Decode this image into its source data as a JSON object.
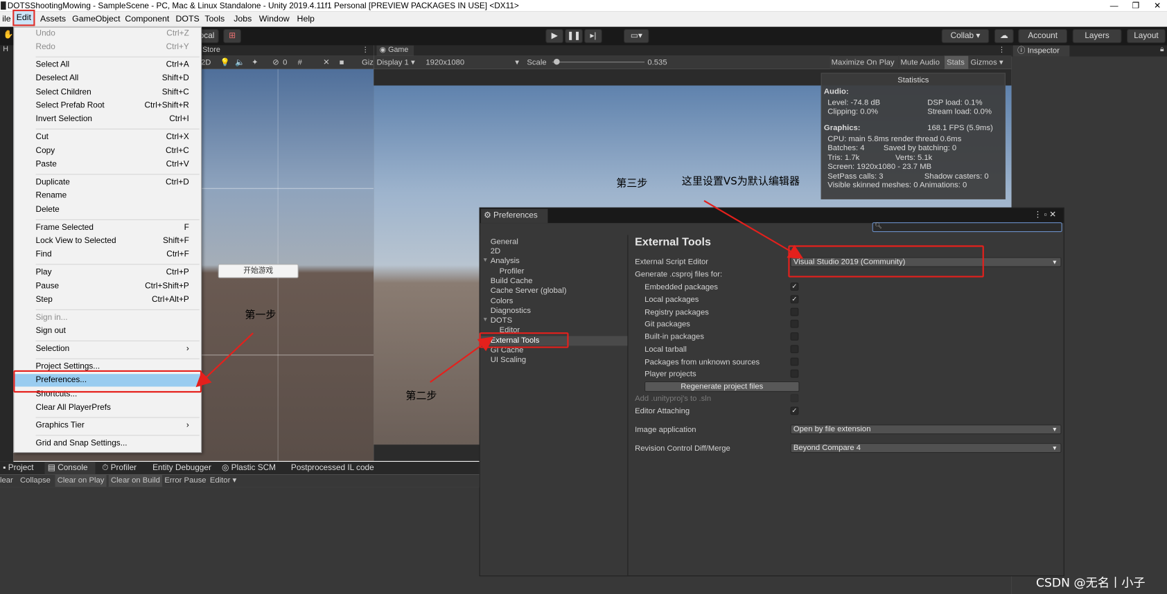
{
  "window": {
    "title": "DOTSShootingMowing - SampleScene - PC, Mac & Linux Standalone - Unity 2019.4.11f1 Personal [PREVIEW PACKAGES IN USE] <DX11>",
    "minimize": "—",
    "restore": "❐",
    "close": "✕"
  },
  "menubar": [
    "ile",
    "Edit",
    "Assets",
    "GameObject",
    "Component",
    "DOTS",
    "Tools",
    "Jobs",
    "Window",
    "Help"
  ],
  "toolbar": {
    "pivot": "ocal",
    "collab": "Collab ▾",
    "account": "Account",
    "layers": "Layers",
    "layout": "Layout"
  },
  "scene_header": {
    "h_tab": "H",
    "store_tab": "Store"
  },
  "scene_toolbar": {
    "mode": "2D",
    "gizmo_count": "0",
    "gizmos": "Giz"
  },
  "scene_button": "开始游戏",
  "game_header": {
    "tab": "Game"
  },
  "game_toolbar": {
    "display": "Display 1",
    "resolution": "1920x1080",
    "scale_label": "Scale",
    "scale_value": "0.535",
    "scale_fraction": 0.02,
    "maximize": "Maximize On Play",
    "mute": "Mute Audio",
    "stats": "Stats",
    "gizmos": "Gizmos"
  },
  "statistics": {
    "title": "Statistics",
    "audio_header": "Audio:",
    "level": "Level: -74.8 dB",
    "dsp": "DSP load: 0.1%",
    "clipping": "Clipping: 0.0%",
    "stream": "Stream load: 0.0%",
    "graphics_header": "Graphics:",
    "fps": "168.1 FPS (5.9ms)",
    "cpu": "CPU: main 5.8ms  render thread 0.6ms",
    "batches": "Batches: 4",
    "saved_batching": "Saved by batching: 0",
    "tris": "Tris: 1.7k",
    "verts": "Verts: 5.1k",
    "screen": "Screen: 1920x1080 - 23.7 MB",
    "setpass": "SetPass calls: 3",
    "shadow": "Shadow casters: 0",
    "skinned": "Visible skinned meshes: 0  Animations: 0"
  },
  "inspector": {
    "tab": "Inspector"
  },
  "bottom_tabs": [
    "Project",
    "Console",
    "Profiler",
    "Entity Debugger",
    "Plastic SCM",
    "Postprocessed IL code"
  ],
  "console_bar": [
    "lear",
    "Collapse",
    "Clear on Play",
    "Clear on Build",
    "Error Pause",
    "Editor ▾"
  ],
  "edit_menu": [
    {
      "label": "Undo",
      "shortcut": "Ctrl+Z",
      "disabled": true
    },
    {
      "label": "Redo",
      "shortcut": "Ctrl+Y",
      "disabled": true
    },
    {
      "label": "Select All",
      "shortcut": "Ctrl+A"
    },
    {
      "label": "Deselect All",
      "shortcut": "Shift+D"
    },
    {
      "label": "Select Children",
      "shortcut": "Shift+C"
    },
    {
      "label": "Select Prefab Root",
      "shortcut": "Ctrl+Shift+R"
    },
    {
      "label": "Invert Selection",
      "shortcut": "Ctrl+I"
    },
    {
      "label": "Cut",
      "shortcut": "Ctrl+X"
    },
    {
      "label": "Copy",
      "shortcut": "Ctrl+C"
    },
    {
      "label": "Paste",
      "shortcut": "Ctrl+V"
    },
    {
      "label": "Duplicate",
      "shortcut": "Ctrl+D"
    },
    {
      "label": "Rename",
      "shortcut": ""
    },
    {
      "label": "Delete",
      "shortcut": ""
    },
    {
      "label": "Frame Selected",
      "shortcut": "F"
    },
    {
      "label": "Lock View to Selected",
      "shortcut": "Shift+F"
    },
    {
      "label": "Find",
      "shortcut": "Ctrl+F"
    },
    {
      "label": "Play",
      "shortcut": "Ctrl+P"
    },
    {
      "label": "Pause",
      "shortcut": "Ctrl+Shift+P"
    },
    {
      "label": "Step",
      "shortcut": "Ctrl+Alt+P"
    },
    {
      "label": "Sign in...",
      "shortcut": "",
      "disabled": true
    },
    {
      "label": "Sign out",
      "shortcut": ""
    },
    {
      "label": "Selection",
      "shortcut": "›"
    },
    {
      "label": "Project Settings...",
      "shortcut": ""
    },
    {
      "label": "Preferences...",
      "shortcut": "",
      "highlighted": true
    },
    {
      "label": "Shortcuts...",
      "shortcut": ""
    },
    {
      "label": "Clear All PlayerPrefs",
      "shortcut": ""
    },
    {
      "label": "Graphics Tier",
      "shortcut": "›"
    },
    {
      "label": "Grid and Snap Settings...",
      "shortcut": ""
    }
  ],
  "preferences": {
    "tab": "Preferences",
    "sidebar": [
      "General",
      "2D",
      "Analysis",
      "Profiler",
      "Build Cache",
      "Cache Server (global)",
      "Colors",
      "Diagnostics",
      "DOTS",
      "Editor",
      "External Tools",
      "GI Cache",
      "UI Scaling"
    ],
    "selected": "External Tools",
    "heading": "External Tools",
    "external_script_editor_label": "External Script Editor",
    "external_script_editor_value": "Visual Studio 2019 (Community)",
    "generate_label": "Generate .csproj files for:",
    "generate_options": [
      {
        "label": "Embedded packages",
        "checked": true
      },
      {
        "label": "Local packages",
        "checked": true
      },
      {
        "label": "Registry packages",
        "checked": false
      },
      {
        "label": "Git packages",
        "checked": false
      },
      {
        "label": "Built-in packages",
        "checked": false
      },
      {
        "label": "Local tarball",
        "checked": false
      },
      {
        "label": "Packages from unknown sources",
        "checked": false
      },
      {
        "label": "Player projects",
        "checked": false
      }
    ],
    "regenerate_button": "Regenerate project files",
    "add_unityproj_label": "Add .unityproj's to .sln",
    "editor_attaching_label": "Editor Attaching",
    "editor_attaching_checked": true,
    "image_application_label": "Image application",
    "image_application_value": "Open by file extension",
    "revision_label": "Revision Control Diff/Merge",
    "revision_value": "Beyond Compare 4"
  },
  "annotations": {
    "step1": "第一步",
    "step2": "第二步",
    "step3": "第三步",
    "note": "这里设置VS为默认编辑器",
    "arrow_color": "#e5201c"
  },
  "watermark": "CSDN @无名丨小子"
}
